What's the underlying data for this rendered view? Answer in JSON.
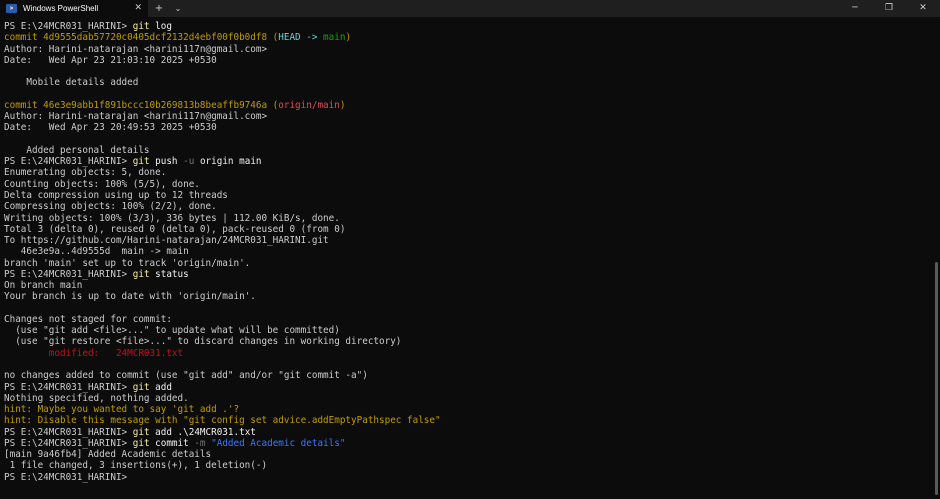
{
  "window": {
    "tab_title": "Windows PowerShell",
    "tab_icon": "powershell-icon",
    "tab_close": "✕",
    "new_tab": "+",
    "dropdown": "⌄",
    "minimize": "─",
    "maximize": "❐",
    "close": "✕"
  },
  "colors": {
    "background": "#0c0c0c",
    "titlebar": "#1f1f1f",
    "text": "#cccccc",
    "yellow": "#c19c00",
    "bright_yellow": "#f9f1a5",
    "cyan": "#61d6d6",
    "green": "#13a10e",
    "red": "#e74856",
    "blue": "#3b78ff"
  },
  "terminal": {
    "lines": [
      [
        {
          "t": "PS E:\\24MCR031_HARINI> ",
          "c": ""
        },
        {
          "t": "git",
          "c": "by"
        },
        {
          "t": " log",
          "c": "w"
        }
      ],
      [
        {
          "t": "commit 4d9555dab57720c0405dcf2132d4ebf00f0b0df8 (",
          "c": "y"
        },
        {
          "t": "HEAD -> ",
          "c": "c"
        },
        {
          "t": "main",
          "c": "g"
        },
        {
          "t": ")",
          "c": "y"
        }
      ],
      [
        {
          "t": "Author: Harini-natarajan <harini117n@gmail.com>",
          "c": ""
        }
      ],
      [
        {
          "t": "Date:   Wed Apr 23 21:03:10 2025 +0530",
          "c": ""
        }
      ],
      [
        {
          "t": "",
          "c": ""
        }
      ],
      [
        {
          "t": "    Mobile details added",
          "c": ""
        }
      ],
      [
        {
          "t": "",
          "c": ""
        }
      ],
      [
        {
          "t": "commit 46e3e9abb1f891bccc10b269813b8beaffb9746a (",
          "c": "y"
        },
        {
          "t": "origin/main",
          "c": "r"
        },
        {
          "t": ")",
          "c": "y"
        }
      ],
      [
        {
          "t": "Author: Harini-natarajan <harini117n@gmail.com>",
          "c": ""
        }
      ],
      [
        {
          "t": "Date:   Wed Apr 23 20:49:53 2025 +0530",
          "c": ""
        }
      ],
      [
        {
          "t": "",
          "c": ""
        }
      ],
      [
        {
          "t": "    Added personal details",
          "c": ""
        }
      ],
      [
        {
          "t": "PS E:\\24MCR031_HARINI> ",
          "c": ""
        },
        {
          "t": "git",
          "c": "by"
        },
        {
          "t": " push ",
          "c": "w"
        },
        {
          "t": "-u",
          "c": "gr"
        },
        {
          "t": " origin main",
          "c": "w"
        }
      ],
      [
        {
          "t": "Enumerating objects: 5, done.",
          "c": ""
        }
      ],
      [
        {
          "t": "Counting objects: 100% (5/5), done.",
          "c": ""
        }
      ],
      [
        {
          "t": "Delta compression using up to 12 threads",
          "c": ""
        }
      ],
      [
        {
          "t": "Compressing objects: 100% (2/2), done.",
          "c": ""
        }
      ],
      [
        {
          "t": "Writing objects: 100% (3/3), 336 bytes | 112.00 KiB/s, done.",
          "c": ""
        }
      ],
      [
        {
          "t": "Total 3 (delta 0), reused 0 (delta 0), pack-reused 0 (from 0)",
          "c": ""
        }
      ],
      [
        {
          "t": "To https://github.com/Harini-natarajan/24MCR031_HARINI.git",
          "c": ""
        }
      ],
      [
        {
          "t": "   46e3e9a..4d9555d  main -> main",
          "c": ""
        }
      ],
      [
        {
          "t": "branch 'main' set up to track 'origin/main'.",
          "c": ""
        }
      ],
      [
        {
          "t": "PS E:\\24MCR031_HARINI> ",
          "c": ""
        },
        {
          "t": "git",
          "c": "by"
        },
        {
          "t": " status",
          "c": "w"
        }
      ],
      [
        {
          "t": "On branch main",
          "c": ""
        }
      ],
      [
        {
          "t": "Your branch is up to date with 'origin/main'.",
          "c": ""
        }
      ],
      [
        {
          "t": "",
          "c": ""
        }
      ],
      [
        {
          "t": "Changes not staged for commit:",
          "c": ""
        }
      ],
      [
        {
          "t": "  (use \"git add <file>...\" to update what will be committed)",
          "c": ""
        }
      ],
      [
        {
          "t": "  (use \"git restore <file>...\" to discard changes in working directory)",
          "c": ""
        }
      ],
      [
        {
          "t": "        modified:   24MCR031.txt",
          "c": "dr"
        }
      ],
      [
        {
          "t": "",
          "c": ""
        }
      ],
      [
        {
          "t": "no changes added to commit (use \"git add\" and/or \"git commit -a\")",
          "c": ""
        }
      ],
      [
        {
          "t": "PS E:\\24MCR031_HARINI> ",
          "c": ""
        },
        {
          "t": "git",
          "c": "by"
        },
        {
          "t": " add",
          "c": "w"
        }
      ],
      [
        {
          "t": "Nothing specified, nothing added.",
          "c": ""
        }
      ],
      [
        {
          "t": "hint: Maybe you wanted to say 'git add .'?",
          "c": "y"
        }
      ],
      [
        {
          "t": "hint: Disable this message with \"git config set advice.addEmptyPathspec false\"",
          "c": "y"
        }
      ],
      [
        {
          "t": "PS E:\\24MCR031_HARINI> ",
          "c": ""
        },
        {
          "t": "git",
          "c": "by"
        },
        {
          "t": " add .\\24MCR031.txt",
          "c": "w"
        }
      ],
      [
        {
          "t": "PS E:\\24MCR031_HARINI> ",
          "c": ""
        },
        {
          "t": "git",
          "c": "by"
        },
        {
          "t": " commit ",
          "c": "w"
        },
        {
          "t": "-m",
          "c": "gr"
        },
        {
          "t": " \"Added Academic details\"",
          "c": "bl"
        }
      ],
      [
        {
          "t": "[main 9a46fb4] Added Academic details",
          "c": ""
        }
      ],
      [
        {
          "t": " 1 file changed, 3 insertions(+), 1 deletion(-)",
          "c": ""
        }
      ],
      [
        {
          "t": "PS E:\\24MCR031_HARINI> ",
          "c": ""
        }
      ]
    ]
  }
}
